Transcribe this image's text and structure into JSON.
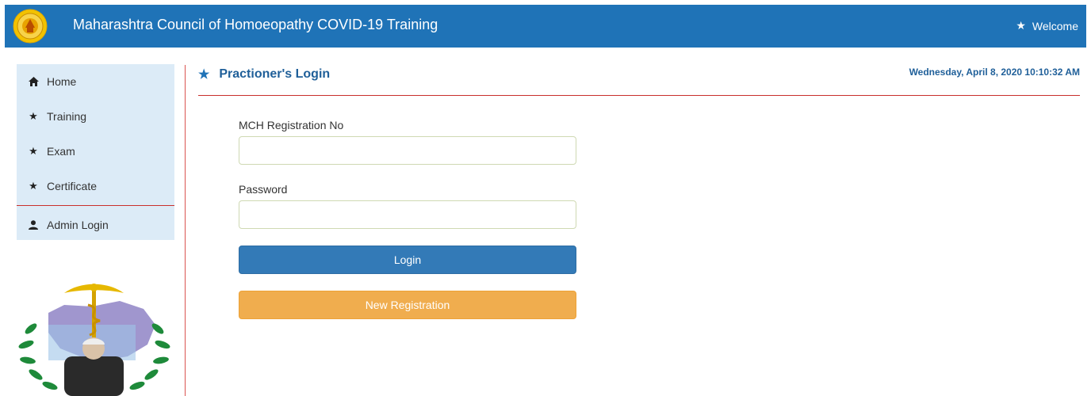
{
  "header": {
    "title": "Maharashtra Council of Homoeopathy COVID-19 Training",
    "welcome": "Welcome"
  },
  "sidebar": {
    "items": [
      {
        "label": "Home",
        "icon": "home-icon"
      },
      {
        "label": "Training",
        "icon": "star-icon"
      },
      {
        "label": "Exam",
        "icon": "star-icon"
      },
      {
        "label": "Certificate",
        "icon": "star-icon"
      },
      {
        "label": "Admin Login",
        "icon": "user-icon"
      }
    ]
  },
  "main": {
    "title": "Practioner's Login",
    "datetime": "Wednesday, April 8, 2020 10:10:32 AM"
  },
  "form": {
    "reg_label": "MCH Registration No",
    "reg_value": "",
    "password_label": "Password",
    "password_value": "",
    "login_button": "Login",
    "register_button": "New Registration"
  },
  "colors": {
    "header_bg": "#1f73b7",
    "sidebar_bg": "#dcebf7",
    "divider": "#c9302c",
    "login_btn": "#337ab7",
    "register_btn": "#f0ad4e"
  }
}
